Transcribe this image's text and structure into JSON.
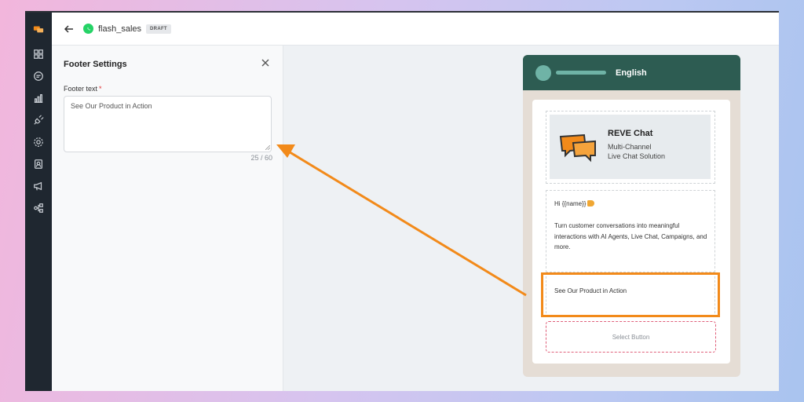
{
  "topbar": {
    "title": "flash_sales",
    "badge": "DRAFT"
  },
  "rail": {
    "icons": [
      "logo-icon",
      "dashboard-icon",
      "chat-icon",
      "analytics-icon",
      "integrations-icon",
      "settings-icon",
      "contacts-icon",
      "campaigns-icon",
      "workflow-icon"
    ]
  },
  "panel": {
    "title": "Footer Settings",
    "footer_label": "Footer text",
    "required_mark": "*",
    "footer_value": "See Our Product in Action",
    "char_count": "25 / 60"
  },
  "preview": {
    "language": "English",
    "header": {
      "brand": "REVE Chat",
      "line1": "Multi-Channel",
      "line2": "Live Chat Solution"
    },
    "body": {
      "greeting": "Hi {{name}}",
      "message": "Turn customer conversations into meaningful interactions with AI Agents, Live Chat, Campaigns, and more."
    },
    "footer_text": "See Our Product in Action",
    "button_label": "Select Button"
  },
  "colors": {
    "rail": "#1f2730",
    "preview_header": "#2d5c52",
    "accent_orange": "#f28a1a",
    "whatsapp_green": "#25d366"
  }
}
